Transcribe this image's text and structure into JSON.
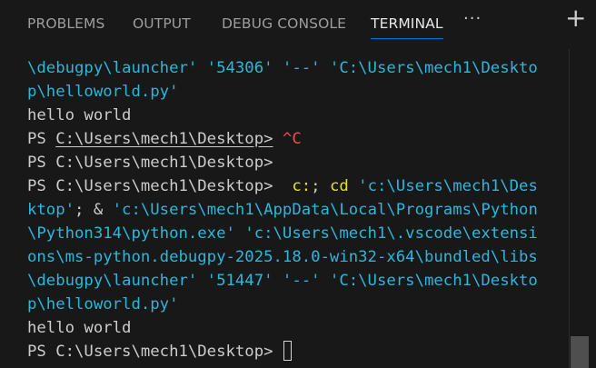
{
  "tabs": [
    {
      "label": "PROBLEMS"
    },
    {
      "label": "OUTPUT"
    },
    {
      "label": "DEBUG CONSOLE"
    },
    {
      "label": "TERMINAL",
      "active": true
    }
  ],
  "tab_more_glyph": "···",
  "tab_add_glyph": "+",
  "terminal": {
    "lines": [
      {
        "segments": [
          {
            "text": "\\debugpy\\launcher' '54306' '--' 'C:\\Users\\mech1\\Deskto",
            "color": "cyan"
          }
        ]
      },
      {
        "segments": [
          {
            "text": "p\\helloworld.py'",
            "color": "cyan"
          }
        ]
      },
      {
        "segments": [
          {
            "text": "hello world",
            "color": "default"
          }
        ]
      },
      {
        "segments": [
          {
            "text": "PS ",
            "color": "default"
          },
          {
            "text": "C:\\Users\\mech1\\Desktop>",
            "color": "default",
            "underline": true
          },
          {
            "text": " ",
            "color": "default"
          },
          {
            "text": "^C",
            "color": "red"
          }
        ]
      },
      {
        "segments": [
          {
            "text": "PS C:\\Users\\mech1\\Desktop>",
            "color": "default"
          }
        ]
      },
      {
        "segments": [
          {
            "text": "PS C:\\Users\\mech1\\Desktop>  ",
            "color": "default"
          },
          {
            "text": "c:",
            "color": "yellow"
          },
          {
            "text": "; ",
            "color": "default"
          },
          {
            "text": "cd",
            "color": "yellow"
          },
          {
            "text": " 'c:\\Users\\mech1\\Des",
            "color": "cyan"
          }
        ]
      },
      {
        "segments": [
          {
            "text": "ktop'",
            "color": "cyan"
          },
          {
            "text": "; & ",
            "color": "default"
          },
          {
            "text": "'c:\\Users\\mech1\\AppData\\Local\\Programs\\Python",
            "color": "cyan"
          }
        ]
      },
      {
        "segments": [
          {
            "text": "\\Python314\\python.exe' 'c:\\Users\\mech1\\.vscode\\extensi",
            "color": "cyan"
          }
        ]
      },
      {
        "segments": [
          {
            "text": "ons\\ms-python.debugpy-2025.18.0-win32-x64\\bundled\\libs",
            "color": "cyan"
          }
        ]
      },
      {
        "segments": [
          {
            "text": "\\debugpy\\launcher' '51447' '--' 'C:\\Users\\mech1\\Deskto",
            "color": "cyan"
          }
        ]
      },
      {
        "segments": [
          {
            "text": "p\\helloworld.py'",
            "color": "cyan"
          }
        ]
      },
      {
        "segments": [
          {
            "text": "hello world",
            "color": "default"
          }
        ]
      },
      {
        "segments": [
          {
            "text": "PS C:\\Users\\mech1\\Desktop> ",
            "color": "default"
          }
        ],
        "cursor": true
      }
    ]
  },
  "colors": {
    "background": "#181818",
    "default_text": "#cccccc",
    "cyan": "#29b8db",
    "yellow": "#e5e510",
    "red": "#f14c4c",
    "active_tab_underline": "#0078d4"
  }
}
